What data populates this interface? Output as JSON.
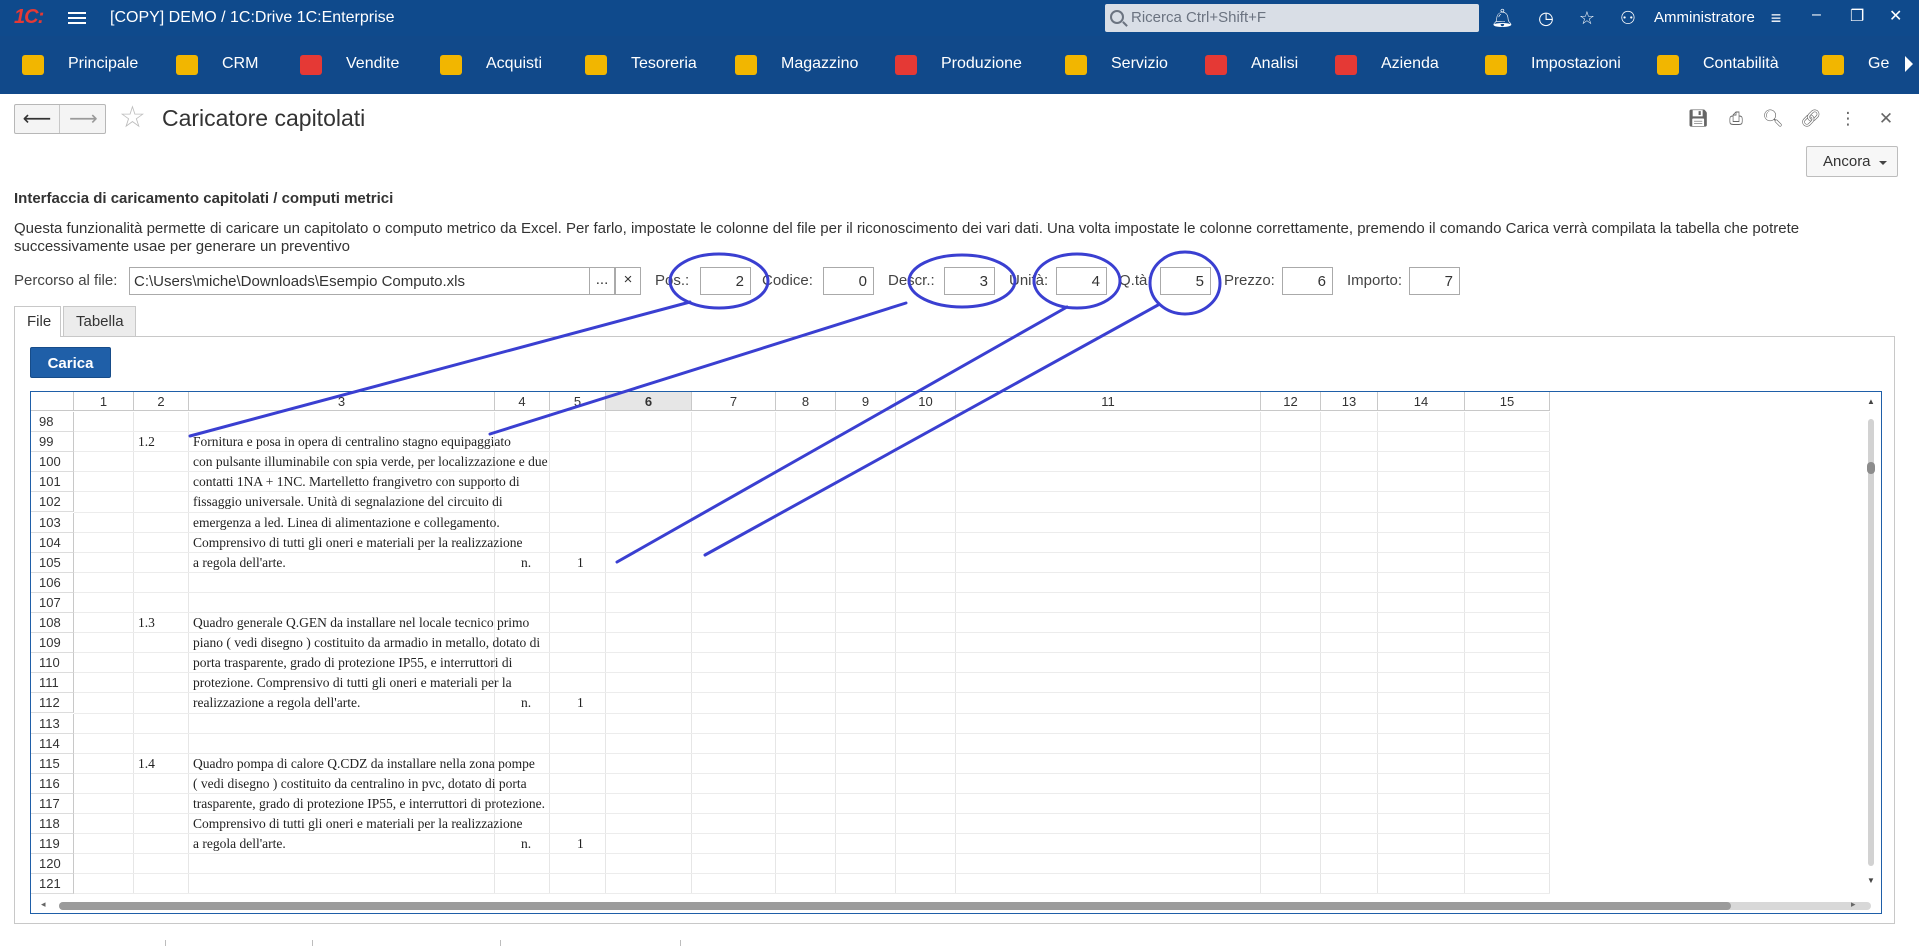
{
  "titlebar": {
    "logo": "1C:",
    "title": "[COPY] DEMO / 1C:Drive 1C:Enterprise",
    "search_placeholder": "Ricerca Ctrl+Shift+F",
    "user": "Amministratore"
  },
  "sections": [
    {
      "label": "Principale",
      "icon": "home-section-icon",
      "color": "#f2b600"
    },
    {
      "label": "CRM",
      "icon": "crm-section-icon",
      "color": "#f2b600"
    },
    {
      "label": "Vendite",
      "icon": "cart-icon",
      "color": "#e53935"
    },
    {
      "label": "Acquisti",
      "icon": "truck-icon",
      "color": "#f2b600"
    },
    {
      "label": "Tesoreria",
      "icon": "treasury-icon",
      "color": "#f2b600"
    },
    {
      "label": "Magazzino",
      "icon": "box-icon",
      "color": "#f2b600"
    },
    {
      "label": "Produzione",
      "icon": "factory-icon",
      "color": "#e53935"
    },
    {
      "label": "Servizio",
      "icon": "service-icon",
      "color": "#f2b600"
    },
    {
      "label": "Analisi",
      "icon": "chart-icon",
      "color": "#e53935"
    },
    {
      "label": "Azienda",
      "icon": "company-icon",
      "color": "#e53935"
    },
    {
      "label": "Impostazioni",
      "icon": "settings-grid-icon",
      "color": "#f2b600"
    },
    {
      "label": "Contabilità",
      "icon": "ledger-icon",
      "color": "#f2b600"
    },
    {
      "label": "Ge",
      "icon": "gear-icon",
      "color": "#f2b600"
    }
  ],
  "form": {
    "title": "Caricatore capitolati",
    "ancora_label": "Ancora",
    "header": "Interfaccia di caricamento capitolati / computi metrici",
    "description": "Questa funzionalità permette di caricare un capitolato o computo metrico da Excel. Per farlo, impostate le colonne del file per il riconoscimento dei vari dati. Una volta impostate le colonne correttamente, premendo il comando Carica verrà compilata la tabella che potrete successivamente usae per generare un preventivo",
    "path_label": "Percorso al file:",
    "path_value": "C:\\Users\\miche\\Downloads\\Esempio Computo.xls",
    "path_select_btn": "...",
    "path_clear_btn": "×",
    "fields": {
      "pos": {
        "label": "Pos.:",
        "value": "2"
      },
      "codice": {
        "label": "Codice:",
        "value": "0"
      },
      "descr": {
        "label": "Descr.:",
        "value": "3"
      },
      "unita": {
        "label": "Unità:",
        "value": "4"
      },
      "qta": {
        "label": "Q.tà:",
        "value": "5"
      },
      "prezzo": {
        "label": "Prezzo:",
        "value": "6"
      },
      "importo": {
        "label": "Importo:",
        "value": "7"
      }
    },
    "tabs": [
      "File",
      "Tabella"
    ],
    "carica_label": "Carica"
  },
  "sheet": {
    "columns": [
      "1",
      "2",
      "3",
      "4",
      "5",
      "6",
      "7",
      "8",
      "9",
      "10",
      "11",
      "12",
      "13",
      "14",
      "15"
    ],
    "selected_column": "6",
    "row_numbers": [
      "98",
      "99",
      "100",
      "101",
      "102",
      "103",
      "104",
      "105",
      "106",
      "107",
      "108",
      "109",
      "110",
      "111",
      "112",
      "113",
      "114",
      "115",
      "116",
      "117",
      "118",
      "119",
      "120",
      "121"
    ],
    "rows": [
      {
        "row": "98",
        "pos": "",
        "descr": "",
        "unit": "",
        "qty": ""
      },
      {
        "row": "99",
        "pos": "1.2",
        "descr": "Fornitura e posa in opera di centralino stagno equipaggiato",
        "unit": "",
        "qty": ""
      },
      {
        "row": "100",
        "pos": "",
        "descr": "con pulsante illuminabile con spia verde, per localizzazione e due",
        "unit": "",
        "qty": ""
      },
      {
        "row": "101",
        "pos": "",
        "descr": "contatti 1NA + 1NC. Martelletto frangivetro con supporto di",
        "unit": "",
        "qty": ""
      },
      {
        "row": "102",
        "pos": "",
        "descr": "fissaggio universale. Unità di segnalazione del circuito di",
        "unit": "",
        "qty": ""
      },
      {
        "row": "103",
        "pos": "",
        "descr": "emergenza a led. Linea di alimentazione e collegamento.",
        "unit": "",
        "qty": ""
      },
      {
        "row": "104",
        "pos": "",
        "descr": "Comprensivo di tutti gli oneri e materiali per la realizzazione",
        "unit": "",
        "qty": ""
      },
      {
        "row": "105",
        "pos": "",
        "descr": " a regola dell'arte.",
        "unit": "n.",
        "qty": "1"
      },
      {
        "row": "106",
        "pos": "",
        "descr": "",
        "unit": "",
        "qty": ""
      },
      {
        "row": "107",
        "pos": "",
        "descr": "",
        "unit": "",
        "qty": ""
      },
      {
        "row": "108",
        "pos": "1.3",
        "descr": "Quadro generale Q.GEN da installare nel locale tecnico primo",
        "unit": "",
        "qty": ""
      },
      {
        "row": "109",
        "pos": "",
        "descr": "piano ( vedi disegno ) costituito da armadio in metallo, dotato di",
        "unit": "",
        "qty": ""
      },
      {
        "row": "110",
        "pos": "",
        "descr": "porta trasparente, grado di protezione IP55, e  interruttori di",
        "unit": "",
        "qty": ""
      },
      {
        "row": "111",
        "pos": "",
        "descr": "protezione. Comprensivo di tutti gli oneri e materiali per la",
        "unit": "",
        "qty": ""
      },
      {
        "row": "112",
        "pos": "",
        "descr": "realizzazione a regola dell'arte.",
        "unit": "n.",
        "qty": "1"
      },
      {
        "row": "113",
        "pos": "",
        "descr": "",
        "unit": "",
        "qty": ""
      },
      {
        "row": "114",
        "pos": "",
        "descr": "",
        "unit": "",
        "qty": ""
      },
      {
        "row": "115",
        "pos": "1.4",
        "descr": "Quadro pompa di calore Q.CDZ da installare nella zona pompe",
        "unit": "",
        "qty": ""
      },
      {
        "row": "116",
        "pos": "",
        "descr": " ( vedi disegno ) costituito da centralino in pvc, dotato di porta",
        "unit": "",
        "qty": ""
      },
      {
        "row": "117",
        "pos": "",
        "descr": "trasparente, grado di protezione IP55, e  interruttori di protezione.",
        "unit": "",
        "qty": ""
      },
      {
        "row": "118",
        "pos": "",
        "descr": "Comprensivo di tutti gli oneri e materiali per la realizzazione",
        "unit": "",
        "qty": ""
      },
      {
        "row": "119",
        "pos": "",
        "descr": " a regola dell'arte.",
        "unit": "n.",
        "qty": "1"
      },
      {
        "row": "120",
        "pos": "",
        "descr": "",
        "unit": "",
        "qty": ""
      },
      {
        "row": "121",
        "pos": "",
        "descr": "",
        "unit": "",
        "qty": ""
      }
    ]
  },
  "annotation_color": "#3a3fd1"
}
